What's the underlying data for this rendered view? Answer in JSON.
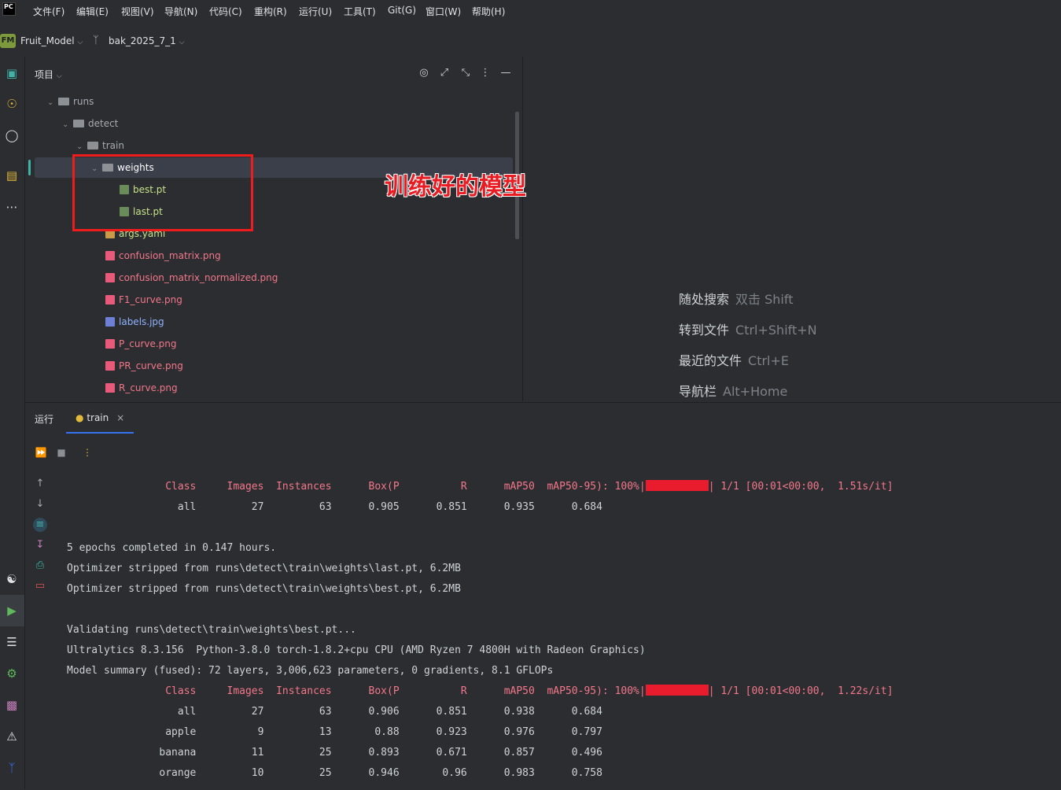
{
  "menubar": {
    "logo_text": "PC",
    "items": [
      "文件(F)",
      "编辑(E)",
      "视图(V)",
      "导航(N)",
      "代码(C)",
      "重构(R)",
      "运行(U)",
      "工具(T)",
      "Git(G)",
      "窗口(W)",
      "帮助(H)"
    ]
  },
  "projectbar": {
    "badge": "FM",
    "project_name": "Fruit_Model",
    "branch": "bak_2025_7_1"
  },
  "project_panel": {
    "title": "项目",
    "tree": [
      {
        "label": "runs",
        "type": "folder",
        "expanded": true
      },
      {
        "label": "detect",
        "type": "folder",
        "expanded": true
      },
      {
        "label": "train",
        "type": "folder",
        "expanded": true
      },
      {
        "label": "weights",
        "type": "folder",
        "expanded": true,
        "selected": true
      },
      {
        "label": "best.pt",
        "type": "pt"
      },
      {
        "label": "last.pt",
        "type": "pt"
      },
      {
        "label": "args.yaml",
        "type": "yaml"
      },
      {
        "label": "confusion_matrix.png",
        "type": "png"
      },
      {
        "label": "confusion_matrix_normalized.png",
        "type": "png"
      },
      {
        "label": "F1_curve.png",
        "type": "png"
      },
      {
        "label": "labels.jpg",
        "type": "jpg"
      },
      {
        "label": "P_curve.png",
        "type": "png"
      },
      {
        "label": "PR_curve.png",
        "type": "png"
      },
      {
        "label": "R_curve.png",
        "type": "png"
      }
    ],
    "annotation": "训练好的模型"
  },
  "editor_hints": [
    {
      "label": "随处搜索",
      "key": "双击 Shift"
    },
    {
      "label": "转到文件",
      "key": "Ctrl+Shift+N"
    },
    {
      "label": "最近的文件",
      "key": "Ctrl+E"
    },
    {
      "label": "导航栏",
      "key": "Alt+Home"
    }
  ],
  "run_panel": {
    "label": "运行",
    "tab": "train",
    "console": [
      {
        "text": "                Class     Images  Instances      Box(P          R      mAP50  mAP50-95): 100%|",
        "tail": "| 1/1 [00:01<00:00,  1.51s/it]",
        "red": true,
        "bar": true
      },
      {
        "text": "                  all         27         63      0.905      0.851      0.935      0.684",
        "red": false
      },
      {
        "text": "",
        "red": false
      },
      {
        "text": "5 epochs completed in 0.147 hours.",
        "red": false
      },
      {
        "text": "Optimizer stripped from runs\\detect\\train\\weights\\last.pt, 6.2MB",
        "red": false
      },
      {
        "text": "Optimizer stripped from runs\\detect\\train\\weights\\best.pt, 6.2MB",
        "red": false
      },
      {
        "text": "",
        "red": false
      },
      {
        "text": "Validating runs\\detect\\train\\weights\\best.pt...",
        "red": false
      },
      {
        "text": "Ultralytics 8.3.156  Python-3.8.0 torch-1.8.2+cpu CPU (AMD Ryzen 7 4800H with Radeon Graphics)",
        "red": false
      },
      {
        "text": "Model summary (fused): 72 layers, 3,006,623 parameters, 0 gradients, 8.1 GFLOPs",
        "red": false
      },
      {
        "text": "                Class     Images  Instances      Box(P          R      mAP50  mAP50-95): 100%|",
        "tail": "| 1/1 [00:01<00:00,  1.22s/it]",
        "red": true,
        "bar": true
      },
      {
        "text": "                  all         27         63      0.906      0.851      0.938      0.684",
        "red": false
      },
      {
        "text": "                apple          9         13       0.88      0.923      0.976      0.797",
        "red": false
      },
      {
        "text": "               banana         11         25      0.893      0.671      0.857      0.496",
        "red": false
      },
      {
        "text": "               orange         10         25      0.946       0.96      0.983      0.758",
        "red": false
      }
    ]
  },
  "colors": {
    "background": "#2b2d30",
    "accent": "#3574f0",
    "annotation": "#e81c22",
    "error_text": "#f2778a"
  }
}
